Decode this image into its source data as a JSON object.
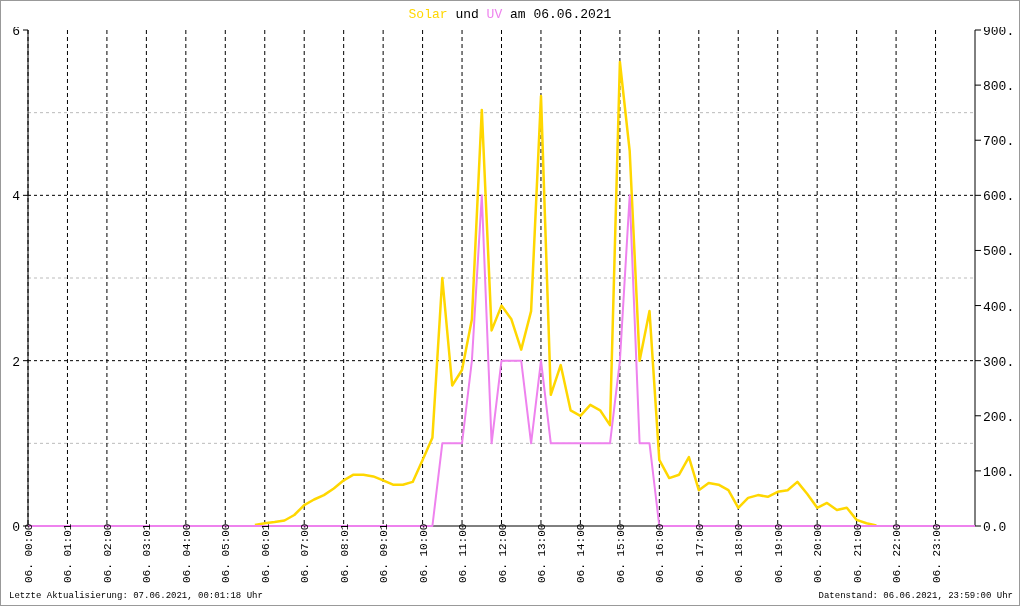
{
  "heading": {
    "joiner": " und ",
    "suffix": " am 06.06.2021"
  },
  "chart_data": {
    "type": "line",
    "grid": true,
    "ylim": [
      0,
      6
    ],
    "y2lim": [
      0,
      900
    ],
    "categories": [
      "06. 00:00",
      null,
      null,
      null,
      "06. 01:01",
      null,
      null,
      null,
      "06. 02:00",
      null,
      null,
      null,
      "06. 03:01",
      null,
      null,
      null,
      "06. 04:00",
      null,
      null,
      null,
      "06. 05:00",
      null,
      null,
      null,
      "06. 06:01",
      null,
      null,
      null,
      "06. 07:00",
      null,
      null,
      null,
      "06. 08:01",
      null,
      null,
      null,
      "06. 09:01",
      null,
      null,
      null,
      "06. 10:00",
      null,
      null,
      null,
      "06. 11:00",
      null,
      null,
      null,
      "06. 12:00",
      null,
      null,
      null,
      "06. 13:00",
      null,
      null,
      null,
      "06. 14:00",
      null,
      null,
      null,
      "06. 15:00",
      null,
      null,
      null,
      "06. 16:00",
      null,
      null,
      null,
      "06. 17:00",
      null,
      null,
      null,
      "06. 18:00",
      null,
      null,
      null,
      "06. 19:00",
      null,
      null,
      null,
      "06. 20:00",
      null,
      null,
      null,
      "06. 21:00",
      null,
      null,
      null,
      "06. 22:00",
      null,
      null,
      null,
      "06. 23:00",
      null,
      null,
      null,
      null
    ],
    "series": [
      {
        "name": "Solar",
        "color": "#ffd700",
        "axis": "y2",
        "values": [
          null,
          null,
          null,
          null,
          null,
          null,
          null,
          null,
          null,
          null,
          null,
          null,
          null,
          null,
          null,
          null,
          null,
          null,
          null,
          null,
          null,
          null,
          null,
          2,
          5,
          7,
          10,
          20,
          38,
          48,
          56,
          68,
          83,
          93,
          93,
          90,
          83,
          75,
          75,
          80,
          120,
          160,
          450,
          255,
          283,
          375,
          755,
          355,
          400,
          375,
          320,
          390,
          780,
          238,
          292,
          210,
          200,
          220,
          210,
          183,
          842,
          680,
          300,
          390,
          120,
          87,
          93,
          125,
          65,
          78,
          75,
          65,
          33,
          51,
          56,
          53,
          62,
          65,
          80,
          58,
          33,
          42,
          29,
          33,
          11,
          5,
          1,
          null,
          null,
          null,
          null,
          null,
          null,
          null,
          null,
          null,
          null
        ]
      },
      {
        "name": "UV",
        "color": "#ee82ee",
        "values": [
          0,
          0,
          0,
          0,
          0,
          0,
          0,
          0,
          0,
          0,
          0,
          0,
          0,
          0,
          0,
          0,
          0,
          0,
          0,
          0,
          0,
          0,
          0,
          0,
          0,
          0,
          0,
          0,
          0,
          0,
          0,
          0,
          0,
          0,
          0,
          0,
          0,
          0,
          0,
          0,
          0,
          0,
          1,
          1,
          1,
          2,
          4,
          1,
          2,
          2,
          2,
          1,
          2,
          1,
          1,
          1,
          1,
          1,
          1,
          1,
          2,
          4,
          1,
          1,
          0,
          0,
          0,
          0,
          0,
          0,
          0,
          0,
          0,
          0,
          0,
          0,
          0,
          0,
          0,
          0,
          0,
          0,
          0,
          0,
          0,
          0,
          0,
          0,
          0,
          0,
          0,
          0,
          0,
          0,
          0,
          0,
          0
        ]
      }
    ],
    "yticks": [
      0,
      2,
      4,
      6
    ],
    "y2ticks": [
      {
        "value": 0,
        "label": "0.0"
      },
      {
        "value": 100,
        "label": "100."
      },
      {
        "value": 200,
        "label": "200."
      },
      {
        "value": 300,
        "label": "300."
      },
      {
        "value": 400,
        "label": "400."
      },
      {
        "value": 500,
        "label": "500."
      },
      {
        "value": 600,
        "label": "600."
      },
      {
        "value": 700,
        "label": "700."
      },
      {
        "value": 800,
        "label": "800."
      },
      {
        "value": 900,
        "label": "900."
      }
    ]
  },
  "footer": {
    "last_update": "Letzte Aktualisierung: 07.06.2021, 00:01:18 Uhr",
    "data_as_of": "Datenstand: 06.06.2021, 23:59:00 Uhr"
  }
}
